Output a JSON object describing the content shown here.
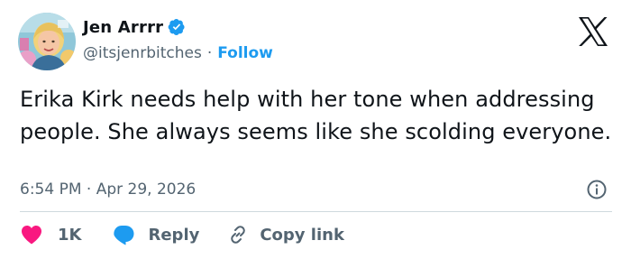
{
  "user": {
    "display_name": "Jen Arrrr",
    "handle": "@itsjenrbitches",
    "separator": "·",
    "follow_label": "Follow",
    "verified": true
  },
  "tweet": {
    "text": "Erika Kirk needs help with her tone when addressing people. She always seems like she scolding everyone.",
    "timestamp": "6:54 PM · Apr 29, 2026"
  },
  "actions": {
    "like_count": "1K",
    "reply_label": "Reply",
    "copy_link_label": "Copy link"
  },
  "colors": {
    "accent": "#1d9bf0",
    "like": "#f91880",
    "text": "#0f1419",
    "muted": "#536471",
    "divider": "#cfd9de"
  },
  "icons": {
    "verified": "verified-badge-icon",
    "logo": "x-logo-icon",
    "info": "info-icon",
    "like": "heart-icon",
    "reply": "speech-bubble-icon",
    "copy_link": "link-icon"
  }
}
